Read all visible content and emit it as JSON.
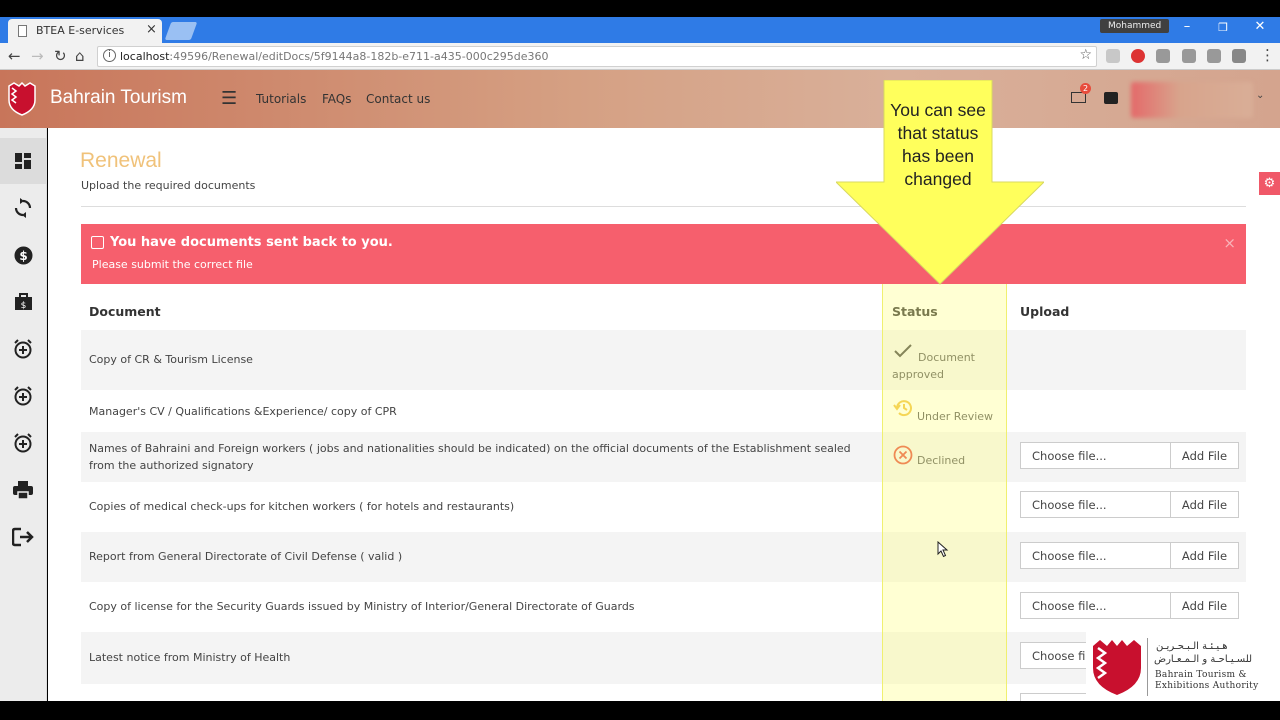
{
  "browser": {
    "tab_title": "BTEA E-services",
    "tab_close": "×",
    "profile_name": "Mohammed",
    "url_host": "localhost",
    "url_rest": ":49596/Renewal/editDocs/5f9144a8-182b-e711-a435-000c295de360",
    "win_min": "–",
    "win_max": "❐",
    "win_close": "✕",
    "back": "←",
    "forward": "→",
    "reload": "↻",
    "home": "⌂",
    "star": "☆",
    "menu": "⋮",
    "info": "i"
  },
  "header": {
    "brand": "Bahrain Tourism",
    "hamburger": "☰",
    "nav": [
      "Tutorials",
      "FAQs",
      "Contact us"
    ],
    "mail_badge": "2",
    "caret": "⌄"
  },
  "page": {
    "title": "Renewal",
    "subtitle": "Upload the required documents",
    "settings_glyph": "⚙"
  },
  "alert": {
    "title": "You have documents sent back to you.",
    "message": "Please submit the correct file",
    "close": "×"
  },
  "table": {
    "headers": [
      "Document",
      "Status",
      "Upload"
    ],
    "rows": [
      {
        "document": "Copy of CR & Tourism License",
        "status": "Document approved",
        "upload": false
      },
      {
        "document": "Manager's CV / Qualifications &Experience/ copy of CPR",
        "status": "Under Review",
        "upload": false
      },
      {
        "document": "Names of Bahraini and Foreign workers ( jobs and nationalities should be indicated) on the official documents of the Establishment sealed from the authorized signatory",
        "status": "Declined",
        "upload": true
      },
      {
        "document": "Copies of medical check-ups for kitchen workers ( for hotels and restaurants)",
        "status": "",
        "upload": true
      },
      {
        "document": "Report from General Directorate of Civil Defense ( valid )",
        "status": "",
        "upload": true
      },
      {
        "document": "Copy of license for the Security Guards issued by Ministry of Interior/General Directorate of Guards",
        "status": "",
        "upload": true
      },
      {
        "document": "Latest notice from Ministry of Health",
        "status": "",
        "upload": true
      }
    ],
    "choose_file": "Choose file...",
    "add_file": "Add File"
  },
  "callout": {
    "text": "You can see that status has been changed"
  },
  "watermark": {
    "arabic_line1": "هـيـئـة الـبـحـريـن",
    "arabic_line2": "للسـيـاحـة و الـمـعـارض",
    "english_line1": "Bahrain Tourism &",
    "english_line2": "Exhibitions Authority"
  },
  "colors": {
    "accent_orange": "#f0c27a",
    "alert_red": "#f65f6d",
    "highlight_yellow": "#ffff82",
    "header_gradient_start": "#c8755a",
    "header_gradient_end": "#d4a48e"
  },
  "icons": {
    "sidebar": [
      "dashboard-icon",
      "renew-icon",
      "payment-icon",
      "briefcase-icon",
      "alarm-add-icon",
      "alarm-add-icon",
      "alarm-add-icon",
      "print-icon",
      "logout-icon"
    ]
  }
}
